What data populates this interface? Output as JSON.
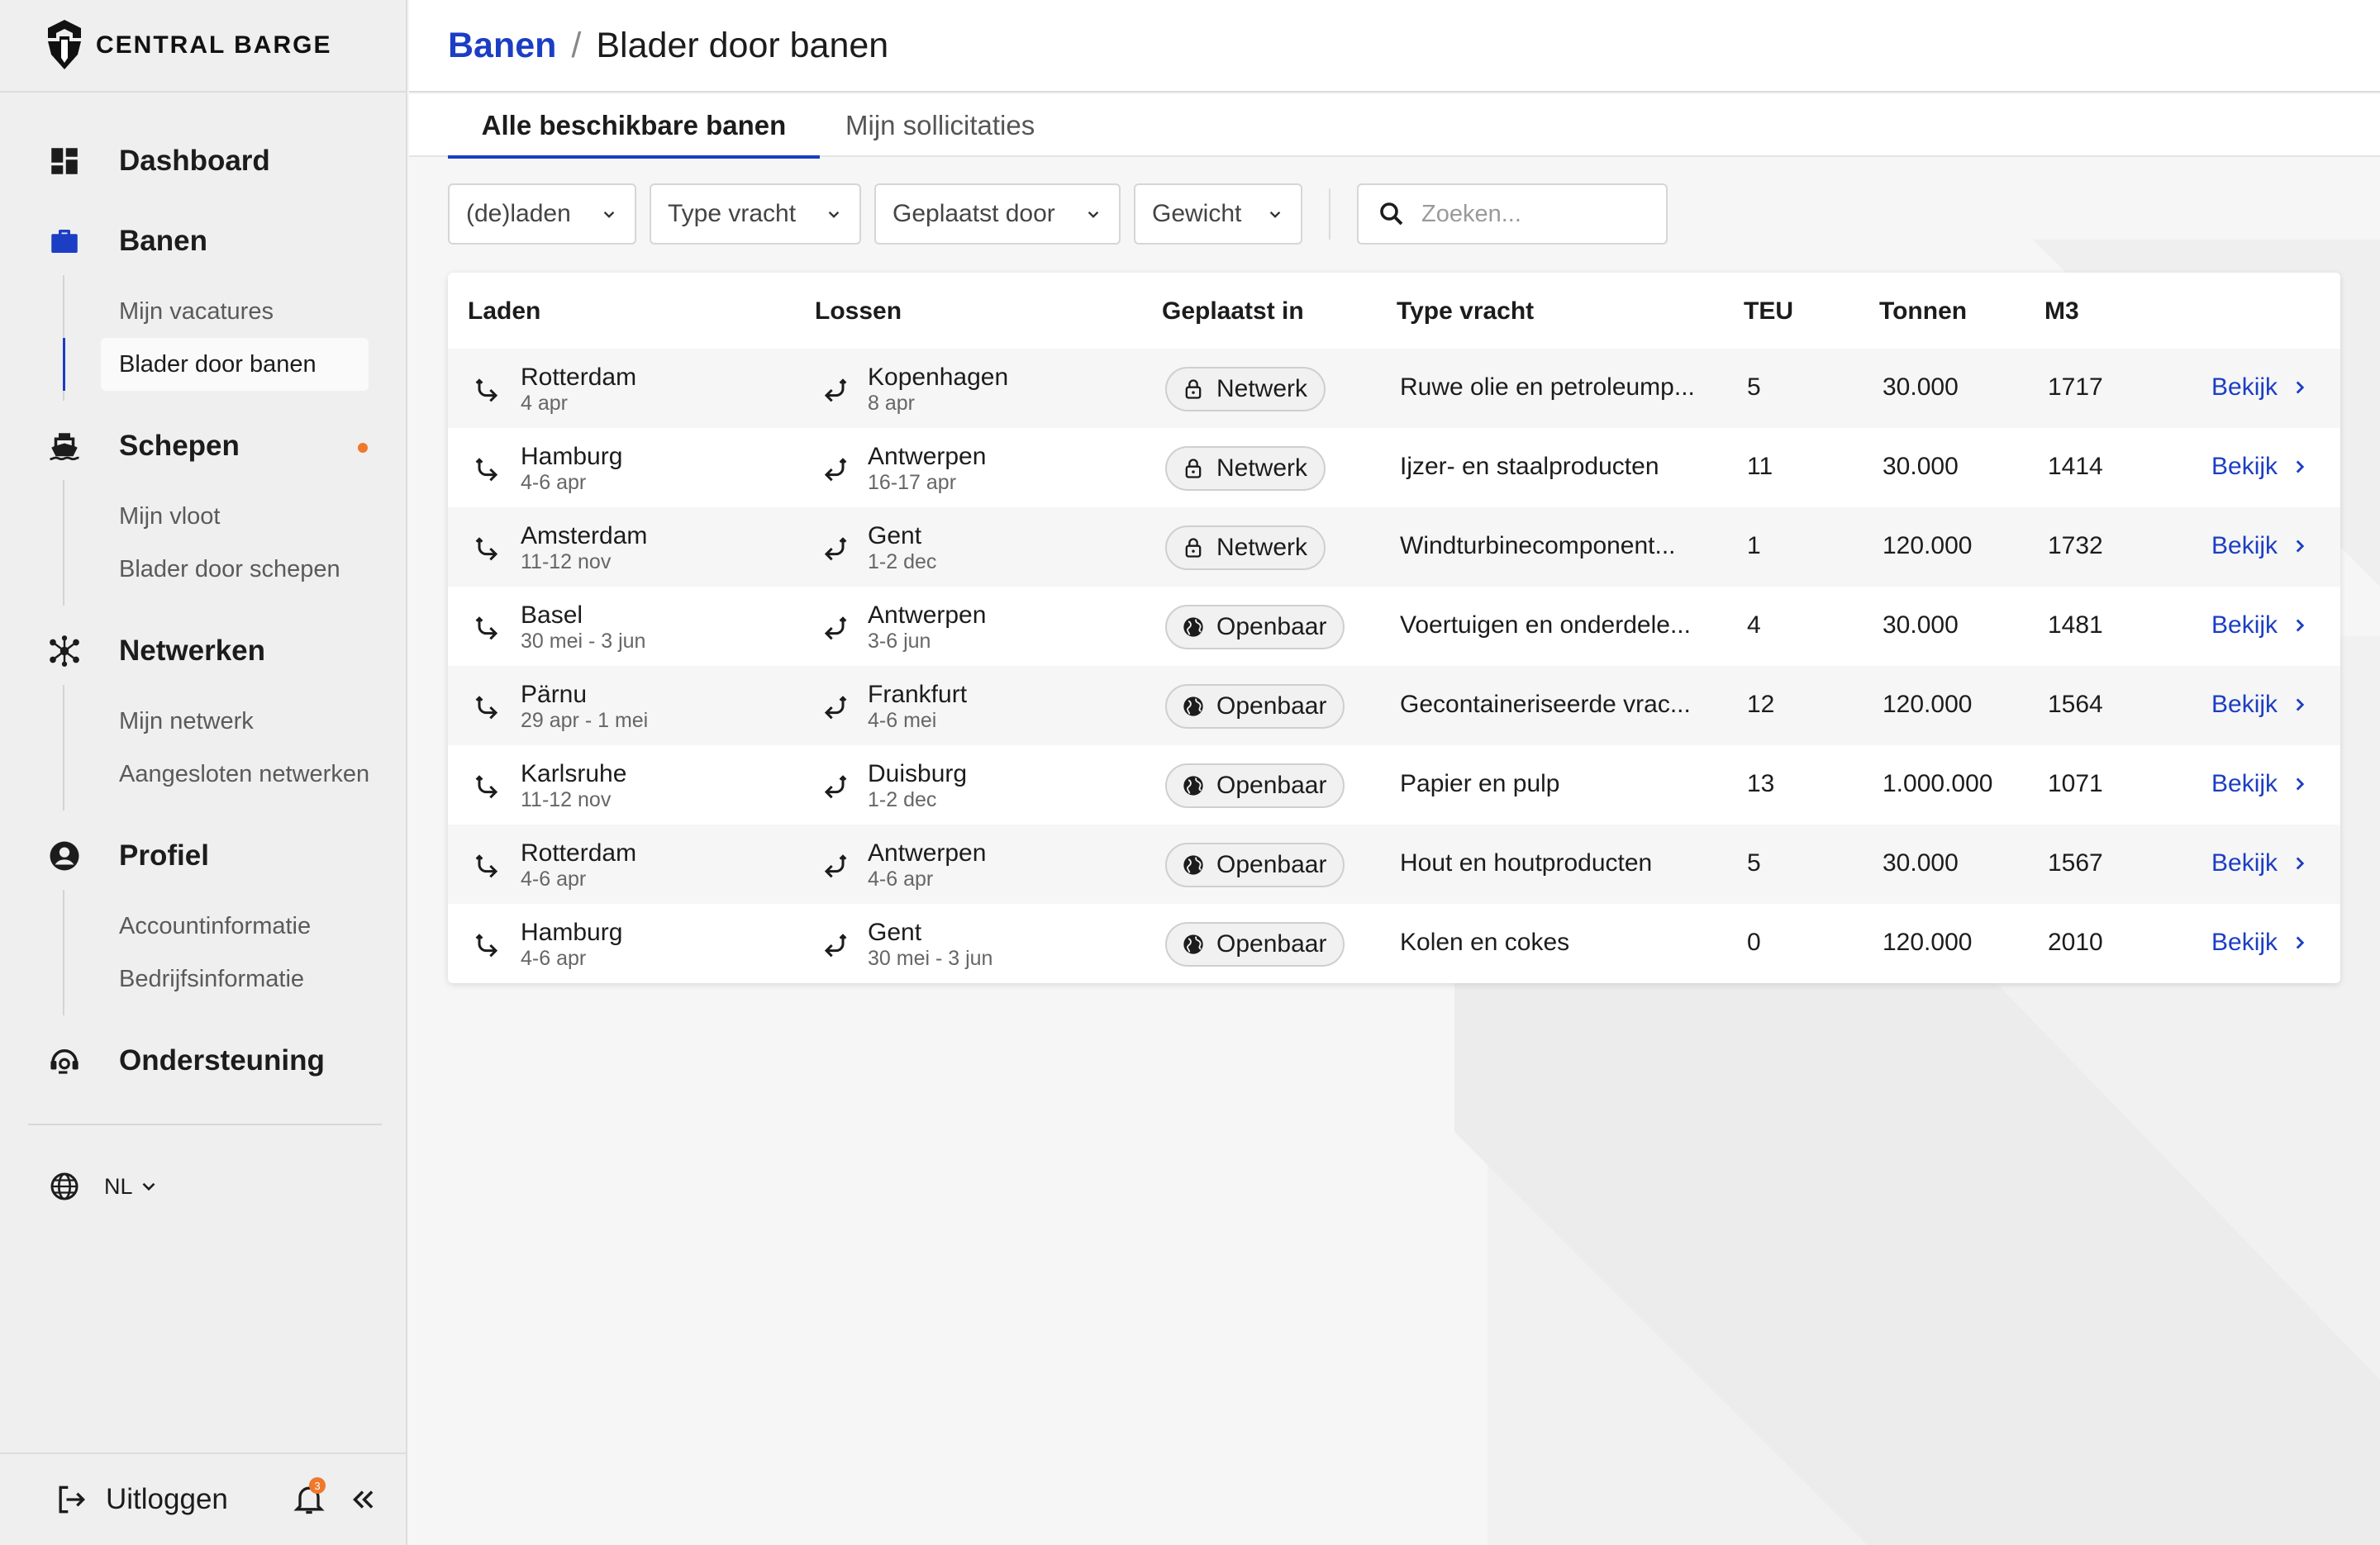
{
  "brand": {
    "name": "CENTRAL BARGE"
  },
  "sidebar": {
    "groups": [
      {
        "label": "Dashboard",
        "icon": "dashboard-icon",
        "items": []
      },
      {
        "label": "Banen",
        "icon": "briefcase-icon",
        "items": [
          "Mijn vacatures",
          "Blader door banen"
        ],
        "active_item": "Blader door banen"
      },
      {
        "label": "Schepen",
        "icon": "ship-icon",
        "has_dot": true,
        "items": [
          "Mijn vloot",
          "Blader door schepen"
        ]
      },
      {
        "label": "Netwerken",
        "icon": "network-icon",
        "items": [
          "Mijn netwerk",
          "Aangesloten netwerken"
        ]
      },
      {
        "label": "Profiel",
        "icon": "user-circle-icon",
        "items": [
          "Accountinformatie",
          "Bedrijfsinformatie"
        ]
      },
      {
        "label": "Ondersteuning",
        "icon": "support-icon",
        "items": []
      }
    ],
    "language": "NL",
    "logout_label": "Uitloggen",
    "notification_count": "3"
  },
  "header": {
    "breadcrumb_link": "Banen",
    "breadcrumb_separator": "/",
    "title": "Blader door banen"
  },
  "tabs": [
    {
      "label": "Alle beschikbare banen",
      "active": true
    },
    {
      "label": "Mijn sollicitaties",
      "active": false
    }
  ],
  "filters": {
    "load": "(de)laden",
    "cargo_type": "Type vracht",
    "posted_by": "Geplaatst door",
    "weight": "Gewicht",
    "search_placeholder": "Zoeken..."
  },
  "table": {
    "columns": [
      "Laden",
      "Lossen",
      "Geplaatst in",
      "Type vracht",
      "TEU",
      "Tonnen",
      "M3"
    ],
    "view_label": "Bekijk",
    "rows": [
      {
        "load_city": "Rotterdam",
        "load_date": "4 apr",
        "unload_city": "Kopenhagen",
        "unload_date": "8 apr",
        "posted_in": "Netwerk",
        "cargo": "Ruwe olie en petroleump...",
        "teu": "5",
        "tons": "30.000",
        "m3": "1717"
      },
      {
        "load_city": "Hamburg",
        "load_date": "4-6 apr",
        "unload_city": "Antwerpen",
        "unload_date": "16-17 apr",
        "posted_in": "Netwerk",
        "cargo": "Ijzer- en staalproducten",
        "teu": "11",
        "tons": "30.000",
        "m3": "1414"
      },
      {
        "load_city": "Amsterdam",
        "load_date": "11-12 nov",
        "unload_city": "Gent",
        "unload_date": "1-2 dec",
        "posted_in": "Netwerk",
        "cargo": "Windturbinecomponent...",
        "teu": "1",
        "tons": "120.000",
        "m3": "1732"
      },
      {
        "load_city": "Basel",
        "load_date": "30 mei - 3 jun",
        "unload_city": "Antwerpen",
        "unload_date": "3-6 jun",
        "posted_in": "Openbaar",
        "cargo": "Voertuigen en onderdele...",
        "teu": "4",
        "tons": "30.000",
        "m3": "1481"
      },
      {
        "load_city": "Pärnu",
        "load_date": "29 apr - 1 mei",
        "unload_city": "Frankfurt",
        "unload_date": "4-6 mei",
        "posted_in": "Openbaar",
        "cargo": "Gecontaineriseerde vrac...",
        "teu": "12",
        "tons": "120.000",
        "m3": "1564"
      },
      {
        "load_city": "Karlsruhe",
        "load_date": "11-12 nov",
        "unload_city": "Duisburg",
        "unload_date": "1-2 dec",
        "posted_in": "Openbaar",
        "cargo": "Papier en pulp",
        "teu": "13",
        "tons": "1.000.000",
        "m3": "1071"
      },
      {
        "load_city": "Rotterdam",
        "load_date": "4-6 apr",
        "unload_city": "Antwerpen",
        "unload_date": "4-6 apr",
        "posted_in": "Openbaar",
        "cargo": "Hout en houtproducten",
        "teu": "5",
        "tons": "30.000",
        "m3": "1567"
      },
      {
        "load_city": "Hamburg",
        "load_date": "4-6 apr",
        "unload_city": "Gent",
        "unload_date": "30 mei - 3 jun",
        "posted_in": "Openbaar",
        "cargo": "Kolen en cokes",
        "teu": "0",
        "tons": "120.000",
        "m3": "2010"
      }
    ]
  },
  "colors": {
    "accent": "#1b3ec4",
    "notification": "#f0782a"
  }
}
